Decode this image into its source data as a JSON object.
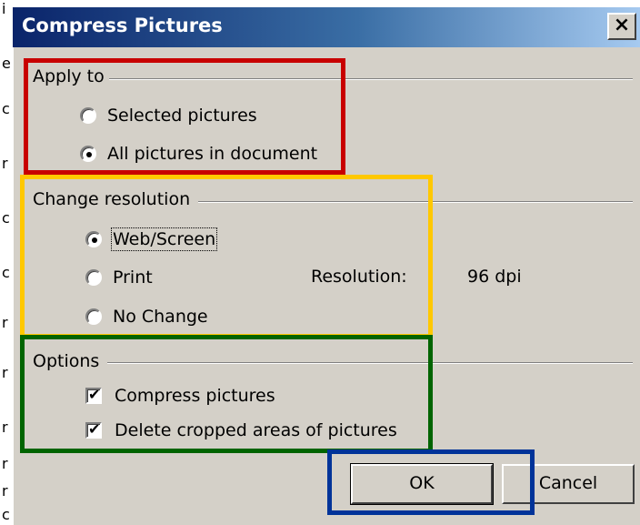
{
  "dialog": {
    "title": "Compress Pictures",
    "close_label": "×"
  },
  "apply_to": {
    "label": "Apply to",
    "options": [
      {
        "label": "Selected pictures",
        "checked": false
      },
      {
        "label": "All pictures in document",
        "checked": true
      }
    ]
  },
  "change_resolution": {
    "label": "Change resolution",
    "options": [
      {
        "label": "Web/Screen",
        "checked": true
      },
      {
        "label": "Print",
        "checked": false
      },
      {
        "label": "No Change",
        "checked": false
      }
    ],
    "resolution_label": "Resolution:",
    "resolution_value": "96 dpi"
  },
  "options": {
    "label": "Options",
    "checkboxes": [
      {
        "label": "Compress pictures",
        "checked": true
      },
      {
        "label": "Delete cropped areas of pictures",
        "checked": true
      }
    ]
  },
  "buttons": {
    "ok": "OK",
    "cancel": "Cancel"
  },
  "highlight_colors": {
    "apply_to": "#c80000",
    "change_resolution": "#ffc800",
    "options": "#006400",
    "ok": "#003399"
  },
  "background_doc_chars": [
    "i",
    "e",
    "c",
    "r",
    "c",
    "c",
    "r",
    "r",
    "r",
    "r",
    "r",
    "c"
  ]
}
